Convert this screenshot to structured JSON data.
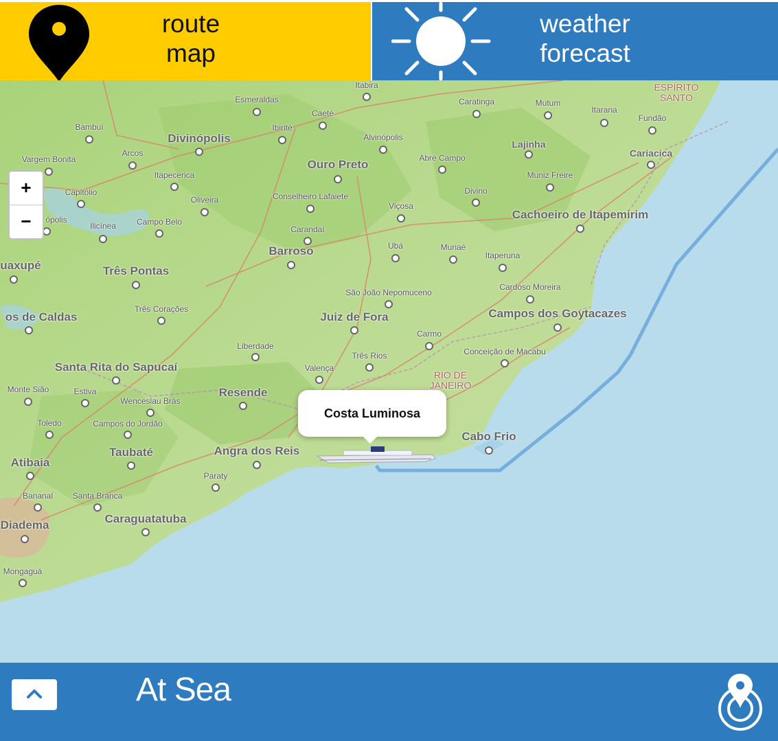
{
  "tabs": {
    "route": {
      "line1": "route",
      "line2": "map",
      "color": "#FFCC00",
      "icon": "map-pin-icon"
    },
    "weather": {
      "line1": "weather",
      "line2": "forecast",
      "color": "#2F7BBF",
      "icon": "sun-icon"
    }
  },
  "map": {
    "zoom_in": "+",
    "zoom_out": "−",
    "popup_label": "Costa Luminosa",
    "route_color": "#6FA8DA",
    "places": [
      {
        "name": "Itabira",
        "cls": ""
      },
      {
        "name": "Esmeraldas",
        "cls": ""
      },
      {
        "name": "Caeté",
        "cls": ""
      },
      {
        "name": "Caratinga",
        "cls": ""
      },
      {
        "name": "Mutum",
        "cls": ""
      },
      {
        "name": "Itarana",
        "cls": ""
      },
      {
        "name": "Fundão",
        "cls": ""
      },
      {
        "name": "ESPÍRITO SANTO",
        "cls": "region"
      },
      {
        "name": "Bambuí",
        "cls": ""
      },
      {
        "name": "Ibirité",
        "cls": ""
      },
      {
        "name": "Divinópolis",
        "cls": "big"
      },
      {
        "name": "Alvinópolis",
        "cls": ""
      },
      {
        "name": "Lajinha",
        "cls": "med"
      },
      {
        "name": "Cariacica",
        "cls": "med"
      },
      {
        "name": "Vargem Bonita",
        "cls": ""
      },
      {
        "name": "Arcos",
        "cls": ""
      },
      {
        "name": "Ouro Preto",
        "cls": "big"
      },
      {
        "name": "Abre Campo",
        "cls": ""
      },
      {
        "name": "Itapecerica",
        "cls": ""
      },
      {
        "name": "Muniz Freire",
        "cls": ""
      },
      {
        "name": "Capitólio",
        "cls": ""
      },
      {
        "name": "Oliveira",
        "cls": ""
      },
      {
        "name": "Conselheiro Lafaiete",
        "cls": ""
      },
      {
        "name": "Divino",
        "cls": ""
      },
      {
        "name": "Viçosa",
        "cls": ""
      },
      {
        "name": "Cachoeiro de Itapemirim",
        "cls": "big"
      },
      {
        "name": "ópolis",
        "cls": ""
      },
      {
        "name": "Ilicínea",
        "cls": ""
      },
      {
        "name": "Campo Belo",
        "cls": ""
      },
      {
        "name": "Carandaí",
        "cls": ""
      },
      {
        "name": "Ubá",
        "cls": ""
      },
      {
        "name": "Muriaé",
        "cls": ""
      },
      {
        "name": "Itaperuna",
        "cls": ""
      },
      {
        "name": "Barroso",
        "cls": "big"
      },
      {
        "name": "uaxupé",
        "cls": "big"
      },
      {
        "name": "Três Pontas",
        "cls": "big"
      },
      {
        "name": "Cardoso Moreira",
        "cls": ""
      },
      {
        "name": "São João Nepomuceno",
        "cls": ""
      },
      {
        "name": "Três Corações",
        "cls": ""
      },
      {
        "name": "Juiz de Fora",
        "cls": "big"
      },
      {
        "name": "Campos dos Goytacazes",
        "cls": "big"
      },
      {
        "name": "os de Caldas",
        "cls": "big"
      },
      {
        "name": "Carmo",
        "cls": ""
      },
      {
        "name": "Liberdade",
        "cls": ""
      },
      {
        "name": "Conceição de Macabu",
        "cls": ""
      },
      {
        "name": "Três Rios",
        "cls": ""
      },
      {
        "name": "Santa Rita do Sapucaí",
        "cls": "big"
      },
      {
        "name": "Valença",
        "cls": ""
      },
      {
        "name": "RIO DE JANEIRO",
        "cls": "region"
      },
      {
        "name": "Monte Sião",
        "cls": ""
      },
      {
        "name": "Estiva",
        "cls": ""
      },
      {
        "name": "Resende",
        "cls": "big"
      },
      {
        "name": "Wenceslau Brás",
        "cls": ""
      },
      {
        "name": "Toledo",
        "cls": ""
      },
      {
        "name": "Campos do Jordão",
        "cls": ""
      },
      {
        "name": "Cabo Frio",
        "cls": "big"
      },
      {
        "name": "Atibaia",
        "cls": "big"
      },
      {
        "name": "Taubaté",
        "cls": "big"
      },
      {
        "name": "Angra dos Reis",
        "cls": "big"
      },
      {
        "name": "Paraty",
        "cls": ""
      },
      {
        "name": "Bananal",
        "cls": ""
      },
      {
        "name": "Santa Branca",
        "cls": ""
      },
      {
        "name": "Caraguatatuba",
        "cls": "big"
      },
      {
        "name": "Diadema",
        "cls": "big"
      },
      {
        "name": "Mongaguá",
        "cls": ""
      }
    ]
  },
  "bottom": {
    "status": "At Sea",
    "expand_icon": "chevron-up-icon",
    "locate_icon": "locate-ship-icon"
  }
}
